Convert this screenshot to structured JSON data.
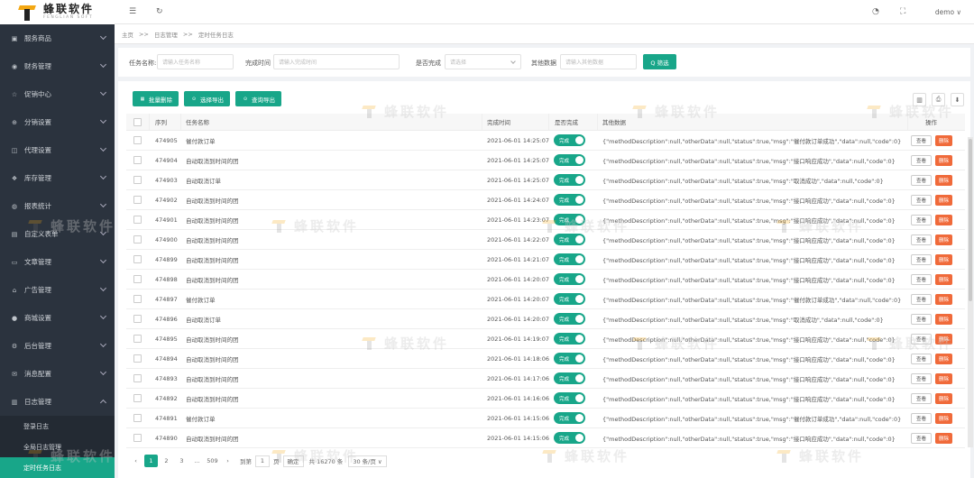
{
  "logo": {
    "cn": "蜂联软件",
    "en": "FENGLIAN SOFT"
  },
  "sidebar": {
    "items": [
      {
        "label": "服务商品",
        "icon": "box-icon",
        "glyph": "▣"
      },
      {
        "label": "财务管理",
        "icon": "finance-icon",
        "glyph": "◉"
      },
      {
        "label": "促销中心",
        "icon": "star-icon",
        "glyph": "☆"
      },
      {
        "label": "分销设置",
        "icon": "share-icon",
        "glyph": "⊕"
      },
      {
        "label": "代理设置",
        "icon": "agent-icon",
        "glyph": "◫"
      },
      {
        "label": "库存管理",
        "icon": "stock-icon",
        "glyph": "❖"
      },
      {
        "label": "报表统计",
        "icon": "report-icon",
        "glyph": "◍"
      },
      {
        "label": "自定义表单",
        "icon": "form-icon",
        "glyph": "▤"
      },
      {
        "label": "文章管理",
        "icon": "article-icon",
        "glyph": "▭"
      },
      {
        "label": "广告管理",
        "icon": "ad-icon",
        "glyph": "⌂"
      },
      {
        "label": "商城设置",
        "icon": "shop-icon",
        "glyph": "●"
      },
      {
        "label": "后台管理",
        "icon": "gear-icon",
        "glyph": "⚙"
      },
      {
        "label": "消息配置",
        "icon": "message-icon",
        "glyph": "✉"
      },
      {
        "label": "日志管理",
        "icon": "log-icon",
        "glyph": "▥"
      }
    ],
    "sub_items": [
      {
        "label": "登录日志"
      },
      {
        "label": "全局日志管理"
      },
      {
        "label": "定时任务日志"
      }
    ]
  },
  "topbar": {
    "menu_glyph": "☰",
    "refresh_glyph": "↻",
    "skin_glyph": "◔",
    "fullscreen_glyph": "⛶",
    "user": "demo ∨"
  },
  "breadcrumb": {
    "items": [
      "主页",
      ">>",
      "日志管理",
      ">>",
      "定时任务日志"
    ]
  },
  "filter": {
    "task_label": "任务名称:",
    "task_placeholder": "请输入任务名称",
    "time_label": "完成时间",
    "time_placeholder": "请输入完成时间",
    "done_label": "是否完成",
    "done_placeholder": "请选择",
    "other_label": "其他数据",
    "other_placeholder": "请输入其他数据",
    "search_label": "Q 筛选"
  },
  "toolbar": {
    "batch_delete": "批量删除",
    "export_selected": "选择导出",
    "export_query": "查询导出",
    "batch_glyph": "▦",
    "export_glyph": "⊙",
    "query_glyph": "⊙",
    "columns_glyph": "▥",
    "print_glyph": "⎙",
    "download_glyph": "⬇"
  },
  "table": {
    "headers": {
      "seq": "序列",
      "task": "任务名称",
      "time": "完成时间",
      "done": "是否完成",
      "other": "其他数据",
      "ops": "操作"
    },
    "toggle_label": "完成",
    "view_label": "查看",
    "delete_label": "删除",
    "rows": [
      {
        "id": "474905",
        "task": "催付款订单",
        "time": "2021-06-01 14:25:07",
        "other": "{\"methodDescription\":null,\"otherData\":null,\"status\":true,\"msg\":\"催付款订单成功\",\"data\":null,\"code\":0}"
      },
      {
        "id": "474904",
        "task": "自动取消到时间的团",
        "time": "2021-06-01 14:25:07",
        "other": "{\"methodDescription\":null,\"otherData\":null,\"status\":true,\"msg\":\"接口响应成功\",\"data\":null,\"code\":0}"
      },
      {
        "id": "474903",
        "task": "自动取消订单",
        "time": "2021-06-01 14:25:07",
        "other": "{\"methodDescription\":null,\"otherData\":null,\"status\":true,\"msg\":\"取消成功\",\"data\":null,\"code\":0}"
      },
      {
        "id": "474902",
        "task": "自动取消到时间的团",
        "time": "2021-06-01 14:24:07",
        "other": "{\"methodDescription\":null,\"otherData\":null,\"status\":true,\"msg\":\"接口响应成功\",\"data\":null,\"code\":0}"
      },
      {
        "id": "474901",
        "task": "自动取消到时间的团",
        "time": "2021-06-01 14:23:07",
        "other": "{\"methodDescription\":null,\"otherData\":null,\"status\":true,\"msg\":\"接口响应成功\",\"data\":null,\"code\":0}"
      },
      {
        "id": "474900",
        "task": "自动取消到时间的团",
        "time": "2021-06-01 14:22:07",
        "other": "{\"methodDescription\":null,\"otherData\":null,\"status\":true,\"msg\":\"接口响应成功\",\"data\":null,\"code\":0}"
      },
      {
        "id": "474899",
        "task": "自动取消到时间的团",
        "time": "2021-06-01 14:21:07",
        "other": "{\"methodDescription\":null,\"otherData\":null,\"status\":true,\"msg\":\"接口响应成功\",\"data\":null,\"code\":0}"
      },
      {
        "id": "474898",
        "task": "自动取消到时间的团",
        "time": "2021-06-01 14:20:07",
        "other": "{\"methodDescription\":null,\"otherData\":null,\"status\":true,\"msg\":\"接口响应成功\",\"data\":null,\"code\":0}"
      },
      {
        "id": "474897",
        "task": "催付款订单",
        "time": "2021-06-01 14:20:07",
        "other": "{\"methodDescription\":null,\"otherData\":null,\"status\":true,\"msg\":\"催付款订单成功\",\"data\":null,\"code\":0}"
      },
      {
        "id": "474896",
        "task": "自动取消订单",
        "time": "2021-06-01 14:20:07",
        "other": "{\"methodDescription\":null,\"otherData\":null,\"status\":true,\"msg\":\"取消成功\",\"data\":null,\"code\":0}"
      },
      {
        "id": "474895",
        "task": "自动取消到时间的团",
        "time": "2021-06-01 14:19:07",
        "other": "{\"methodDescription\":null,\"otherData\":null,\"status\":true,\"msg\":\"接口响应成功\",\"data\":null,\"code\":0}"
      },
      {
        "id": "474894",
        "task": "自动取消到时间的团",
        "time": "2021-06-01 14:18:06",
        "other": "{\"methodDescription\":null,\"otherData\":null,\"status\":true,\"msg\":\"接口响应成功\",\"data\":null,\"code\":0}"
      },
      {
        "id": "474893",
        "task": "自动取消到时间的团",
        "time": "2021-06-01 14:17:06",
        "other": "{\"methodDescription\":null,\"otherData\":null,\"status\":true,\"msg\":\"接口响应成功\",\"data\":null,\"code\":0}"
      },
      {
        "id": "474892",
        "task": "自动取消到时间的团",
        "time": "2021-06-01 14:16:06",
        "other": "{\"methodDescription\":null,\"otherData\":null,\"status\":true,\"msg\":\"接口响应成功\",\"data\":null,\"code\":0}"
      },
      {
        "id": "474891",
        "task": "催付款订单",
        "time": "2021-06-01 14:15:06",
        "other": "{\"methodDescription\":null,\"otherData\":null,\"status\":true,\"msg\":\"催付款订单成功\",\"data\":null,\"code\":0}"
      },
      {
        "id": "474890",
        "task": "自动取消到时间的团",
        "time": "2021-06-01 14:15:06",
        "other": "{\"methodDescription\":null,\"otherData\":null,\"status\":true,\"msg\":\"接口响应成功\",\"data\":null,\"code\":0}"
      }
    ]
  },
  "pagination": {
    "prev": "‹",
    "pages": [
      "1",
      "2",
      "3",
      "…",
      "509"
    ],
    "next": "›",
    "goto_label": "到第",
    "goto_value": "1",
    "page_unit": "页",
    "confirm": "确定",
    "total": "共 16270 条",
    "page_size": "30 条/页 ∨"
  },
  "watermark": {
    "text": "蜂联软件"
  },
  "colors": {
    "accent": "#18a689",
    "danger": "#f06a3a",
    "sidebar": "#2b333e"
  }
}
